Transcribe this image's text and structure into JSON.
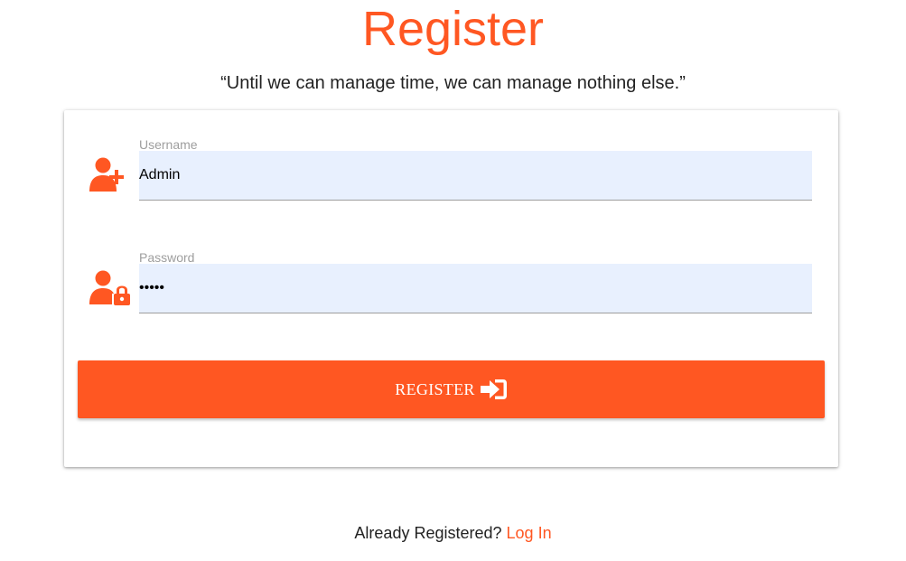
{
  "header": {
    "title": "Register",
    "quote": "“Until we can manage time, we can manage nothing else.”"
  },
  "form": {
    "username": {
      "label": "Username",
      "value": "Admin",
      "icon": "user-plus-icon"
    },
    "password": {
      "label": "Password",
      "value": "•••••",
      "icon": "user-lock-icon"
    },
    "submit": {
      "label": "REGISTER",
      "icon": "sign-in-icon"
    }
  },
  "footer": {
    "prompt": "Already Registered?",
    "link_label": "Log In"
  },
  "colors": {
    "accent": "#ff5722",
    "input_bg": "#e8f0fe",
    "text": "#222222",
    "label": "#9e9e9e"
  }
}
